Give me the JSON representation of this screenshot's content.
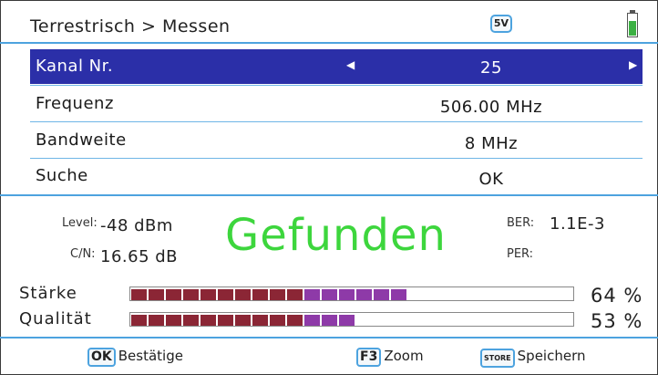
{
  "header": {
    "title": "Terrestrisch > Messen",
    "badge": "5V",
    "battery_level": 0.7,
    "battery_color": "#3cb043"
  },
  "menu": {
    "rows": [
      {
        "label": "Kanal Nr.",
        "value": "25",
        "selected": true
      },
      {
        "label": "Frequenz",
        "value": "506.00 MHz",
        "selected": false
      },
      {
        "label": "Bandweite",
        "value": "8 MHz",
        "selected": false
      },
      {
        "label": "Suche",
        "value": "OK",
        "selected": false
      }
    ],
    "selected_color": "#2b2fa8"
  },
  "measure": {
    "level_label": "Level:",
    "level_value": "-48 dBm",
    "cn_label": "C/N:",
    "cn_value": "16.65 dB",
    "status": "Gefunden",
    "status_color": "#3dd63d",
    "ber_label": "BER:",
    "ber_value": "1.1E-3",
    "per_label": "PER:",
    "per_value": ""
  },
  "bars": [
    {
      "label": "Stärke",
      "percent_text": "64 %",
      "level": 0.64,
      "red_segments": 10
    },
    {
      "label": "Qualität",
      "percent_text": "53 %",
      "level": 0.53,
      "red_segments": 10
    }
  ],
  "bar_colors": {
    "red": "#8b2635",
    "purple": "#8e3aa8"
  },
  "footer": {
    "ok_key": "OK",
    "ok_label": "Bestätige",
    "f3_key": "F3",
    "f3_label": "Zoom",
    "store_key": "STORE",
    "store_label": "Speichern"
  }
}
